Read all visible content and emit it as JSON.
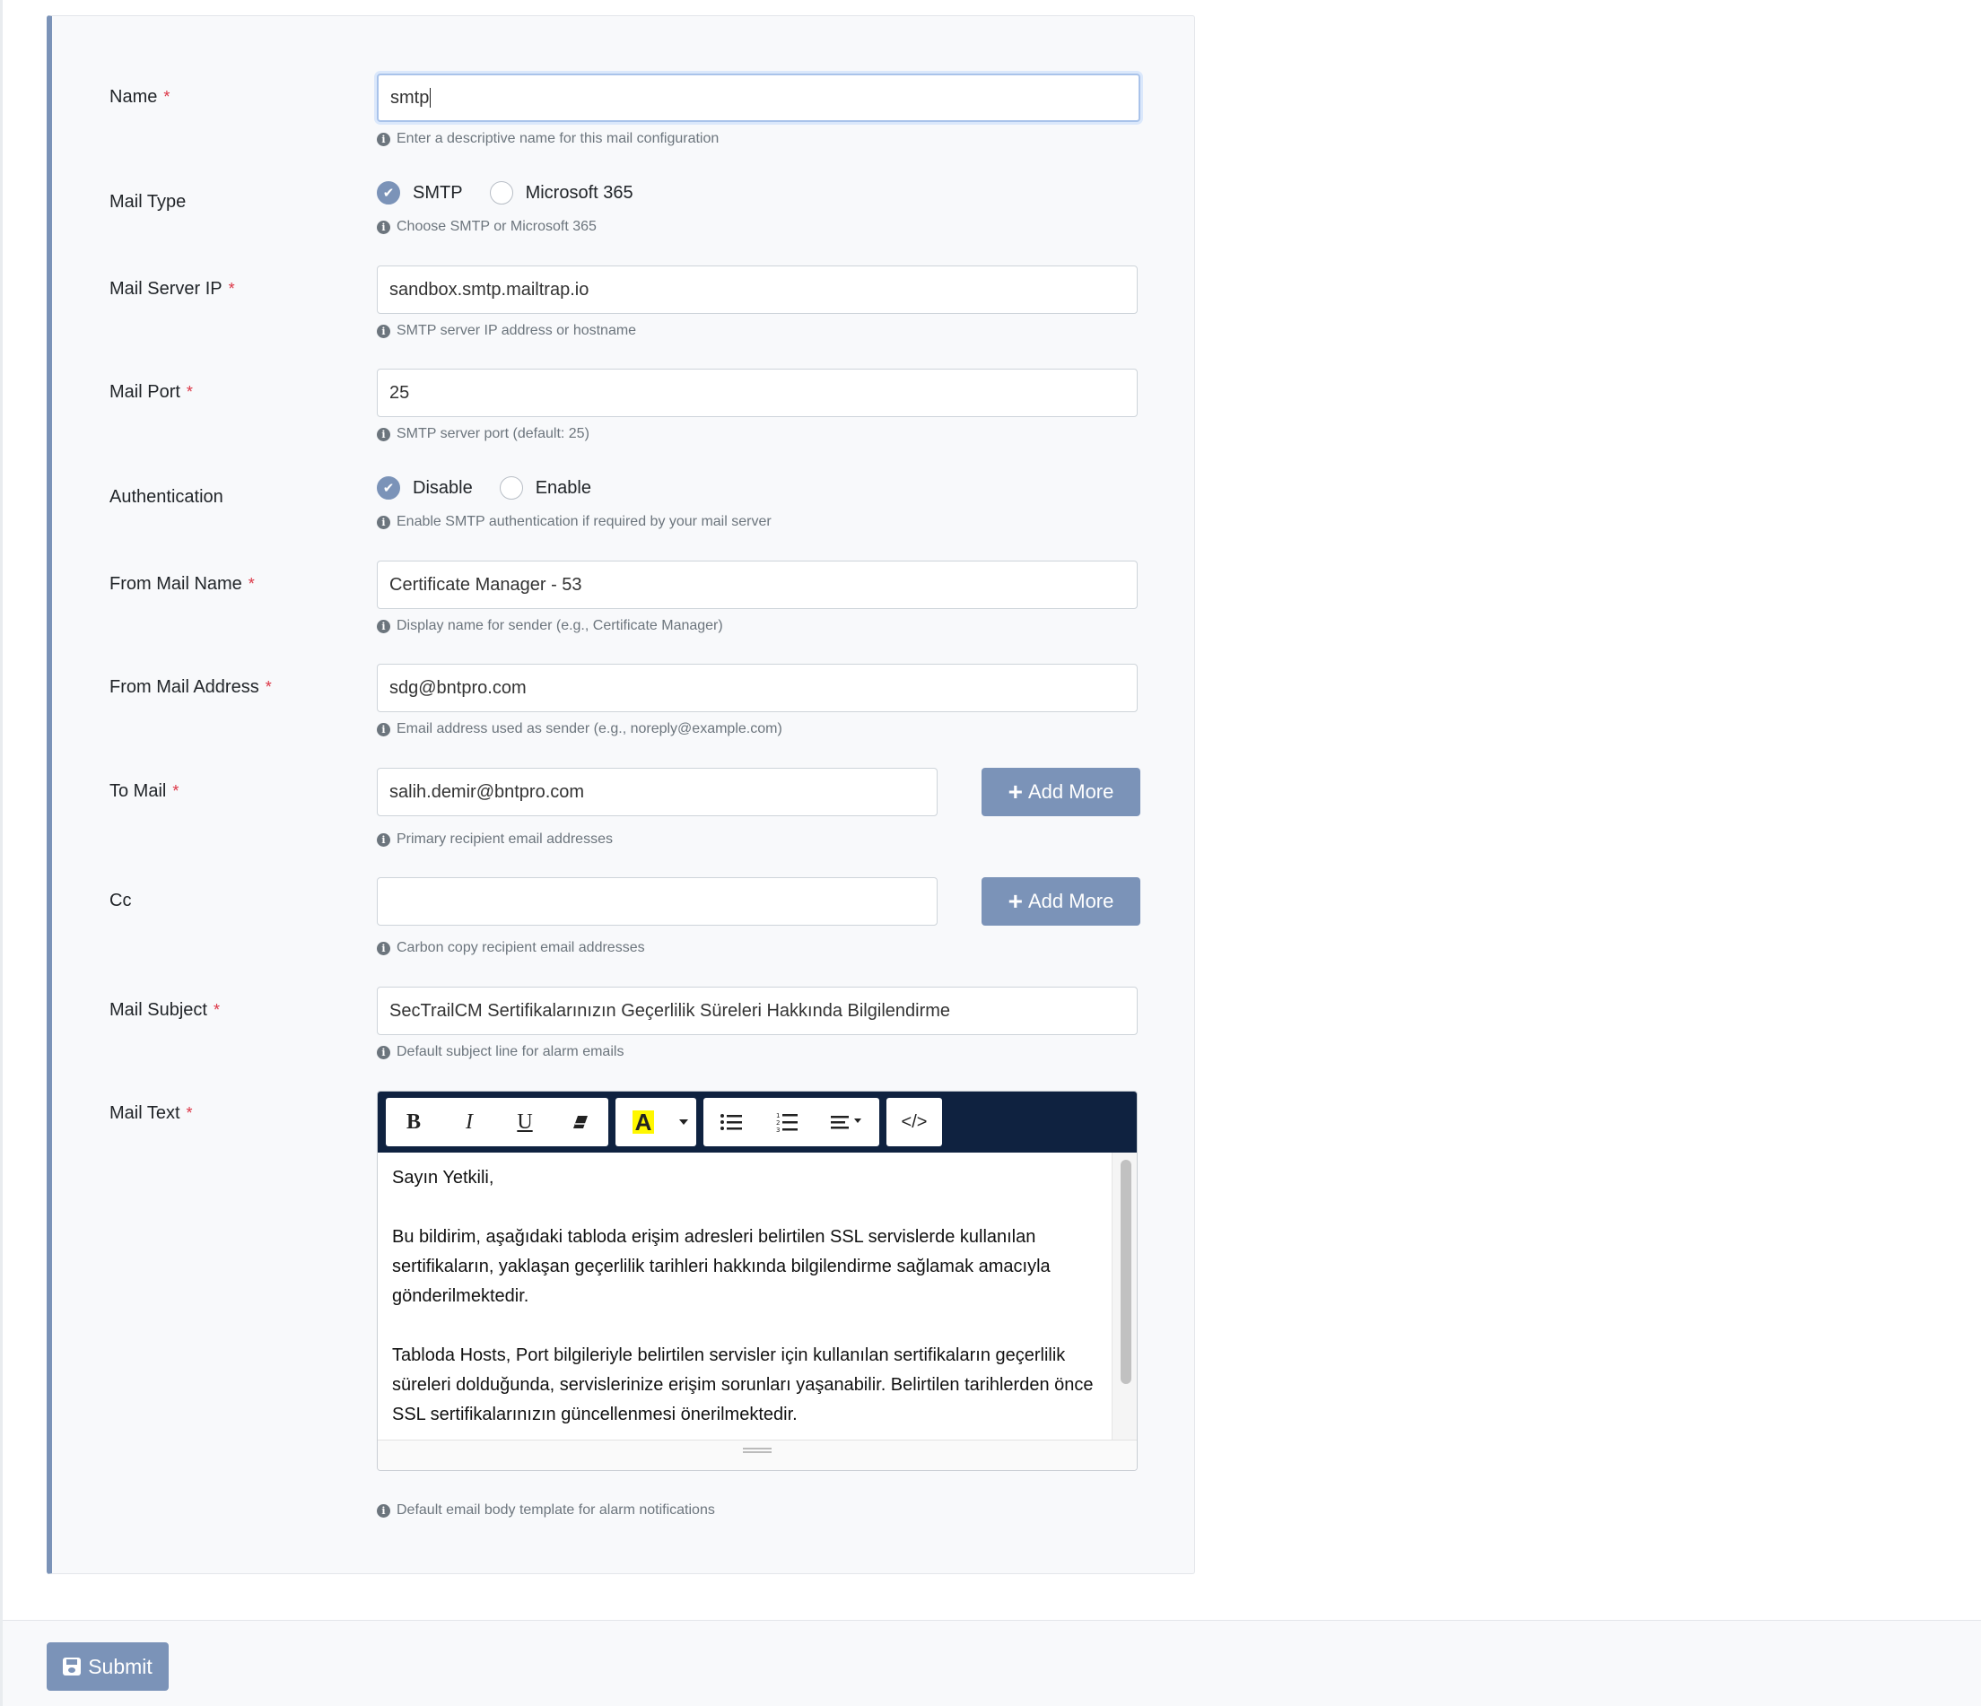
{
  "form": {
    "required_mark": "*",
    "name": {
      "label": "Name",
      "value": "smtp",
      "help": "Enter a descriptive name for this mail configuration"
    },
    "mail_type": {
      "label": "Mail Type",
      "options": [
        "SMTP",
        "Microsoft 365"
      ],
      "selected": "SMTP",
      "help": "Choose SMTP or Microsoft 365"
    },
    "mail_server_ip": {
      "label": "Mail Server IP",
      "value": "sandbox.smtp.mailtrap.io",
      "help": "SMTP server IP address or hostname"
    },
    "mail_port": {
      "label": "Mail Port",
      "value": "25",
      "help": "SMTP server port (default: 25)"
    },
    "authentication": {
      "label": "Authentication",
      "options": [
        "Disable",
        "Enable"
      ],
      "selected": "Disable",
      "help": "Enable SMTP authentication if required by your mail server"
    },
    "from_mail_name": {
      "label": "From Mail Name",
      "value": "Certificate Manager - 53",
      "help": "Display name for sender (e.g., Certificate Manager)"
    },
    "from_mail_address": {
      "label": "From Mail Address",
      "value": "sdg@bntpro.com",
      "help": "Email address used as sender (e.g., noreply@example.com)"
    },
    "to_mail": {
      "label": "To Mail",
      "value": "salih.demir@bntpro.com",
      "help": "Primary recipient email addresses",
      "button": "Add More"
    },
    "cc": {
      "label": "Cc",
      "value": "",
      "help": "Carbon copy recipient email addresses",
      "button": "Add More"
    },
    "mail_subject": {
      "label": "Mail Subject",
      "value": "SecTrailCM Sertifikalarınızın Geçerlilik Süreleri Hakkında Bilgilendirme",
      "help": "Default subject line for alarm emails"
    },
    "mail_text": {
      "label": "Mail Text",
      "help": "Default email body template for alarm notifications",
      "toolbar": {
        "bold": "B",
        "italic": "I",
        "underline": "U",
        "code": "</>"
      },
      "paragraphs": [
        "Sayın Yetkili,",
        "Bu bildirim, aşağıdaki tabloda erişim adresleri belirtilen SSL servislerde kullanılan sertifikaların, yaklaşan geçerlilik tarihleri hakkında bilgilendirme sağlamak amacıyla gönderilmektedir.",
        "Tabloda Hosts, Port bilgileriyle belirtilen servisler için kullanılan sertifikaların geçerlilik süreleri dolduğunda, servislerinize erişim sorunları yaşanabilir. Belirtilen tarihlerden önce SSL sertifikalarınızın güncellenmesi önerilmektedir."
      ]
    }
  },
  "footer": {
    "submit_label": "Submit"
  },
  "colors": {
    "accent": "#7b93b8",
    "required": "#dc3545",
    "toolbar_bg": "#0f2240"
  }
}
